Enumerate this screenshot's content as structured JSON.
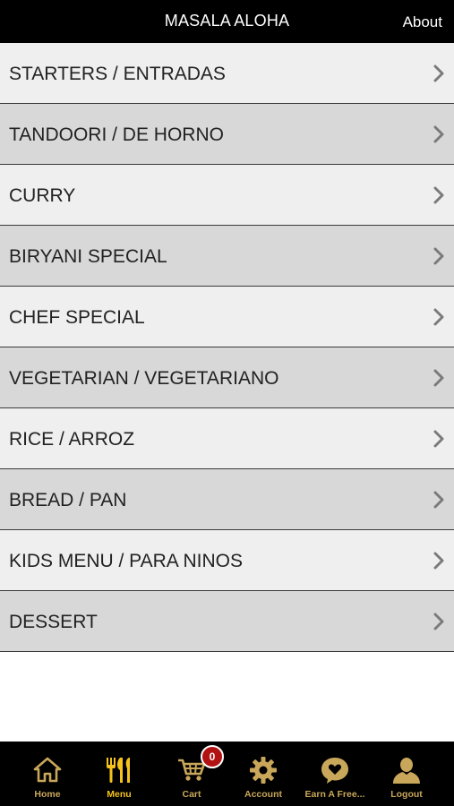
{
  "header": {
    "title": "MASALA ALOHA",
    "about_label": "About"
  },
  "menu": {
    "items": [
      {
        "label": "STARTERS / ENTRADAS"
      },
      {
        "label": "TANDOORI / DE HORNO"
      },
      {
        "label": "CURRY"
      },
      {
        "label": "BIRYANI SPECIAL"
      },
      {
        "label": "CHEF SPECIAL"
      },
      {
        "label": "VEGETARIAN / VEGETARIANO"
      },
      {
        "label": "RICE / ARROZ"
      },
      {
        "label": "BREAD / PAN"
      },
      {
        "label": "KIDS MENU / PARA NINOS"
      },
      {
        "label": "DESSERT"
      }
    ],
    "chevron_icon": "chevron-right-icon"
  },
  "tabbar": {
    "active": "Menu",
    "tabs": [
      {
        "label": "Home",
        "icon": "home-icon"
      },
      {
        "label": "Menu",
        "icon": "fork-knife-icon"
      },
      {
        "label": "Cart",
        "icon": "cart-icon",
        "badge": "0"
      },
      {
        "label": "Account",
        "icon": "gear-icon"
      },
      {
        "label": "Earn A Free...",
        "icon": "heart-bubble-icon"
      },
      {
        "label": "Logout",
        "icon": "user-icon"
      }
    ]
  },
  "colors": {
    "header_bg": "#000000",
    "row_light": "#efefef",
    "row_dark": "#d8d8d8",
    "tab_icon": "#c9a75a",
    "tab_active": "#f5c31c",
    "badge_bg": "#b31212"
  }
}
